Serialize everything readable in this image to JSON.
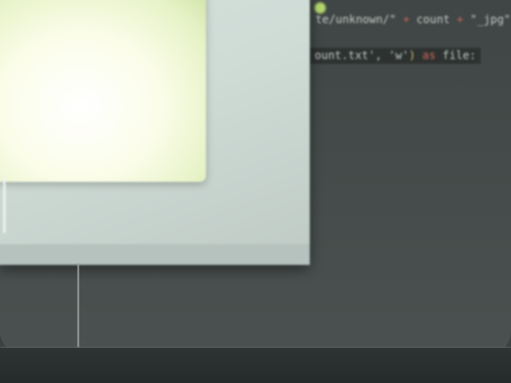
{
  "code": {
    "line1_pre": "te/unknown/\" ",
    "line1_op1": "+",
    "line1_mid": " count ",
    "line1_op2": "+",
    "line1_post": " \"_jpg\"",
    "line2_pre": "ount.txt', 'w'",
    "line2_paren": ")",
    "line2_op": " as",
    "line2_post": " file:"
  },
  "colors": {
    "screen": "#3f4645",
    "bezel": "#252a2a",
    "window": "#cfdcd6",
    "highlight": "#fbfde9",
    "accent_red": "#e06a5a",
    "accent_green": "#9fcf62"
  },
  "dots": [
    "#a8d46a",
    "#b6d86c",
    "#c8e07a",
    "#e06a5a",
    "#9fcf62",
    "#a8d46a",
    "#b6d86c"
  ]
}
